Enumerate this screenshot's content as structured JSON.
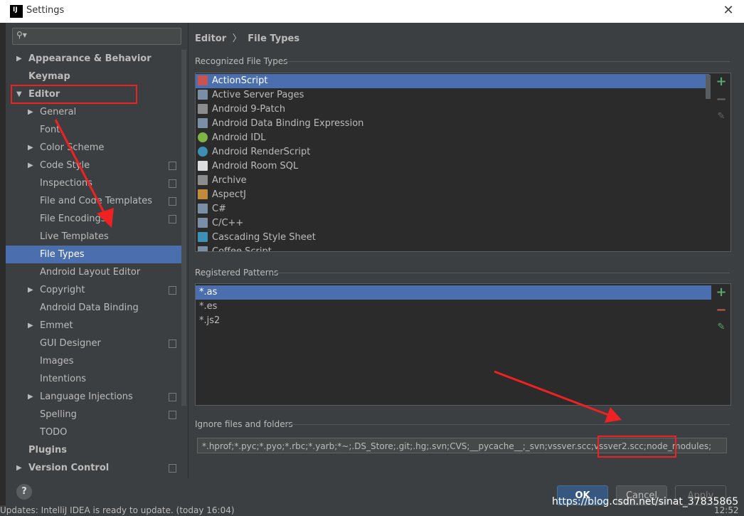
{
  "window": {
    "title": "Settings",
    "close": "✕"
  },
  "sidebar": {
    "search_placeholder": "",
    "items": [
      {
        "label": "Appearance & Behavior",
        "bold": true,
        "arrow": "▶",
        "indent": 0
      },
      {
        "label": "Keymap",
        "bold": true,
        "arrow": "",
        "indent": 0
      },
      {
        "label": "Editor",
        "bold": true,
        "arrow": "▼",
        "indent": 0
      },
      {
        "label": "General",
        "bold": false,
        "arrow": "▶",
        "indent": 1
      },
      {
        "label": "Font",
        "bold": false,
        "arrow": "",
        "indent": 1
      },
      {
        "label": "Color Scheme",
        "bold": false,
        "arrow": "▶",
        "indent": 1
      },
      {
        "label": "Code Style",
        "bold": false,
        "arrow": "▶",
        "indent": 1,
        "copy": true
      },
      {
        "label": "Inspections",
        "bold": false,
        "arrow": "",
        "indent": 1,
        "copy": true
      },
      {
        "label": "File and Code Templates",
        "bold": false,
        "arrow": "",
        "indent": 1,
        "copy": true
      },
      {
        "label": "File Encodings",
        "bold": false,
        "arrow": "",
        "indent": 1,
        "copy": true
      },
      {
        "label": "Live Templates",
        "bold": false,
        "arrow": "",
        "indent": 1
      },
      {
        "label": "File Types",
        "bold": false,
        "arrow": "",
        "indent": 1,
        "selected": true
      },
      {
        "label": "Android Layout Editor",
        "bold": false,
        "arrow": "",
        "indent": 1
      },
      {
        "label": "Copyright",
        "bold": false,
        "arrow": "▶",
        "indent": 1,
        "copy": true
      },
      {
        "label": "Android Data Binding",
        "bold": false,
        "arrow": "",
        "indent": 1
      },
      {
        "label": "Emmet",
        "bold": false,
        "arrow": "▶",
        "indent": 1
      },
      {
        "label": "GUI Designer",
        "bold": false,
        "arrow": "",
        "indent": 1,
        "copy": true
      },
      {
        "label": "Images",
        "bold": false,
        "arrow": "",
        "indent": 1
      },
      {
        "label": "Intentions",
        "bold": false,
        "arrow": "",
        "indent": 1
      },
      {
        "label": "Language Injections",
        "bold": false,
        "arrow": "▶",
        "indent": 1,
        "copy": true
      },
      {
        "label": "Spelling",
        "bold": false,
        "arrow": "",
        "indent": 1,
        "copy": true
      },
      {
        "label": "TODO",
        "bold": false,
        "arrow": "",
        "indent": 1
      },
      {
        "label": "Plugins",
        "bold": true,
        "arrow": "",
        "indent": 0
      },
      {
        "label": "Version Control",
        "bold": true,
        "arrow": "▶",
        "indent": 0,
        "copy": true
      }
    ]
  },
  "breadcrumb": {
    "parent": "Editor",
    "separator": "〉",
    "current": "File Types"
  },
  "recognized": {
    "label": "Recognized File Types",
    "items": [
      {
        "label": "ActionScript",
        "icon": "actionscript-icon",
        "color": "#c75450",
        "selected": true
      },
      {
        "label": "Active Server Pages",
        "icon": "file-person-icon",
        "color": "#7a8fa6"
      },
      {
        "label": "Android 9-Patch",
        "icon": "folder-icon",
        "color": "#8c8c8c"
      },
      {
        "label": "Android Data Binding Expression",
        "icon": "file-person-icon",
        "color": "#7a8fa6"
      },
      {
        "label": "Android IDL",
        "icon": "android-icon",
        "color": "#7fb347"
      },
      {
        "label": "Android RenderScript",
        "icon": "renderscript-icon",
        "color": "#3d8fb5"
      },
      {
        "label": "Android Room SQL",
        "icon": "table-icon",
        "color": "#dddddd"
      },
      {
        "label": "Archive",
        "icon": "archive-icon",
        "color": "#8c8c8c"
      },
      {
        "label": "AspectJ",
        "icon": "aspectj-icon",
        "color": "#c08b3c"
      },
      {
        "label": "C#",
        "icon": "file-person-icon",
        "color": "#7a8fa6"
      },
      {
        "label": "C/C++",
        "icon": "file-person-icon",
        "color": "#7a8fa6"
      },
      {
        "label": "Cascading Style Sheet",
        "icon": "css-icon",
        "color": "#3d8fb5"
      },
      {
        "label": "Coffee Script",
        "icon": "coffee-icon",
        "color": "#7a8fa6"
      }
    ]
  },
  "patterns": {
    "label": "Registered Patterns",
    "items": [
      {
        "label": "*.as",
        "selected": true
      },
      {
        "label": "*.es"
      },
      {
        "label": "*.js2"
      }
    ]
  },
  "ignore": {
    "label": "Ignore files and folders",
    "value": "*.hprof;*.pyc;*.pyo;*.rbc;*.yarb;*~;.DS_Store;.git;.hg;.svn;CVS;__pycache__;_svn;vssver.scc;vssver2.scc;node_modules;"
  },
  "buttons": {
    "ok": "OK",
    "cancel": "Cancel",
    "apply": "Apply",
    "help": "?"
  },
  "status": {
    "text": "Updates: IntelliJ IDEA is ready to update. (today 16:04)",
    "time": "12:52"
  },
  "watermark": "https://blog.csdn.net/sinat_37835865",
  "colors": {
    "accent": "#4b6eaf",
    "background": "#3c3f41",
    "panel": "#2b2b2b",
    "annotation": "#ee2222",
    "add": "#59a869",
    "remove": "#c75450"
  }
}
